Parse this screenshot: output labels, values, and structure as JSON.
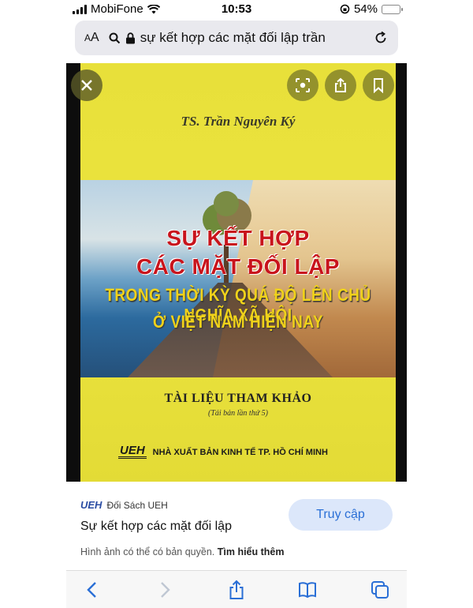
{
  "status_bar": {
    "carrier": "MobiFone",
    "time": "10:53",
    "battery": "54%",
    "battery_level": 0.54
  },
  "address_bar": {
    "aa_label": "AA",
    "url_text": "sự kết hợp các mặt đối lập trần"
  },
  "cover": {
    "author": "TS. Trần Nguyên Ký",
    "title_line1": "SỰ KẾT HỢP",
    "title_line2": "CÁC MẶT ĐỐI LẬP",
    "subtitle_line1": "TRONG THỜI KỲ QUÁ ĐỘ LÊN CHỦ NGHĨA XÃ HỘI",
    "subtitle_line2": "Ở VIỆT NAM HIỆN NAY",
    "reference": "TÀI LIỆU THAM KHẢO",
    "edition": "(Tái bản lần thứ 5)",
    "logo_text": "UEH",
    "publisher": "NHÀ XUẤT BẢN KINH TẾ TP. HỒ CHÍ MINH"
  },
  "caption": {
    "source_logo": "UEH",
    "source_name": "Đối Sách UEH",
    "title": "Sự kết hợp các mặt đối lập",
    "visit_button": "Truy cập",
    "copyright_text": "Hình ảnh có thể có bản quyền.",
    "learn_more": "Tìm hiểu thêm"
  },
  "colors": {
    "accent": "#2a6fd6",
    "cover_yellow": "#ece43e"
  }
}
